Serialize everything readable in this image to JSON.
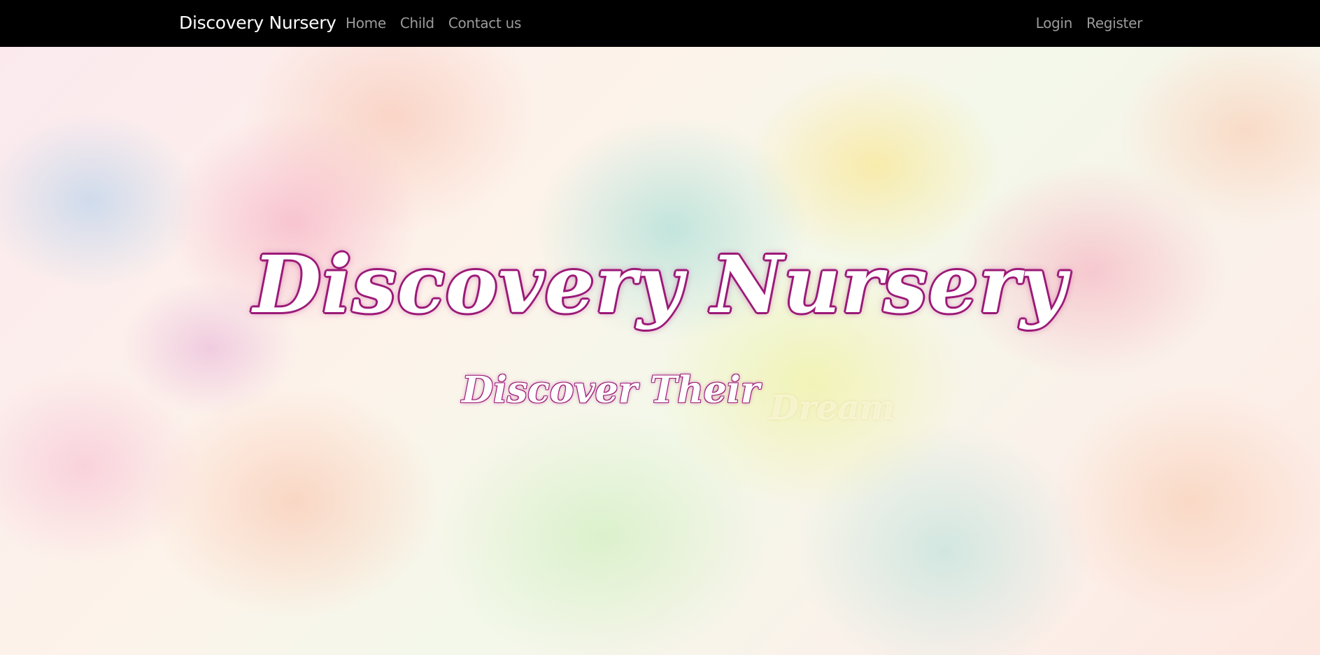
{
  "navbar": {
    "brand": "Discovery Nursery",
    "left_links": [
      "Home",
      "Child",
      "Contact us"
    ],
    "right_links": [
      "Login",
      "Register"
    ],
    "background": "#000000",
    "link_color": "#9b9b9b"
  },
  "hero": {
    "title": "Discovery Nursery",
    "subtitle_strong": "Discover Their",
    "subtitle_faint": "Dream",
    "title_outline_color": "#9c1a78"
  }
}
